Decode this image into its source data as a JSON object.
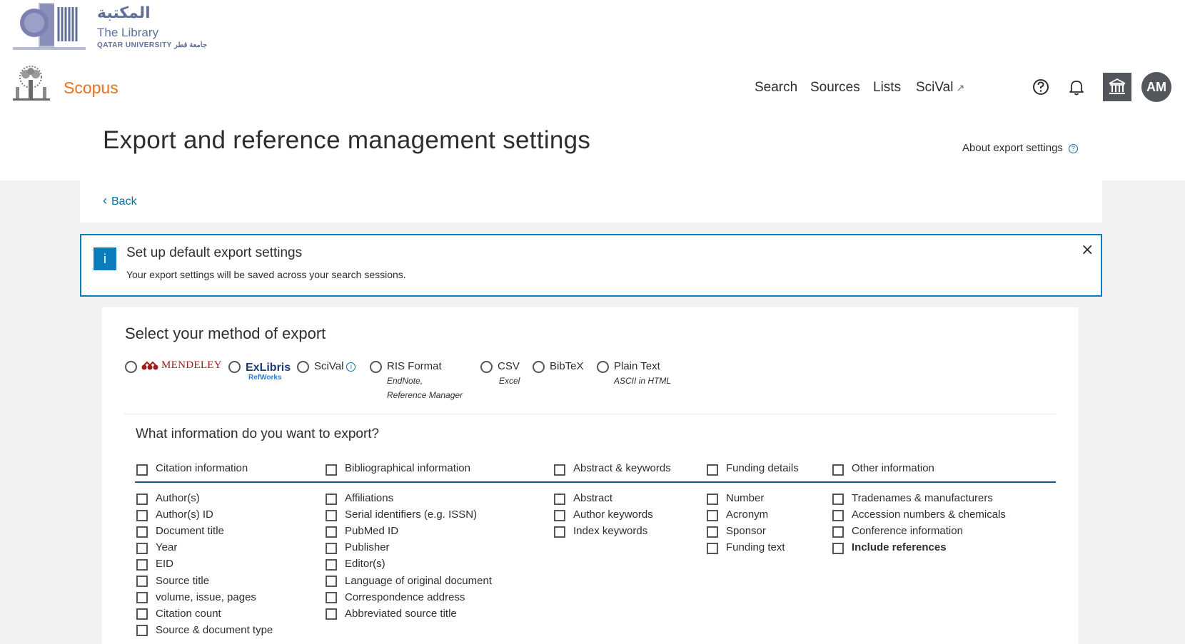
{
  "library": {
    "arabic": "المكتبة",
    "name": "The Library",
    "university": "QATAR UNIVERSITY جامعة قطر"
  },
  "header": {
    "brand": "Scopus",
    "nav": [
      "Search",
      "Sources",
      "Lists",
      "SciVal"
    ],
    "scival_arrow": "↗",
    "avatar_initials": "AM",
    "icons": [
      "help-icon",
      "bell-icon",
      "institution-icon"
    ]
  },
  "page": {
    "title": "Export and reference management settings",
    "about_link": "About export settings",
    "back": "Back"
  },
  "banner": {
    "icon": "i",
    "title": "Set up default export settings",
    "text": "Your export settings will be saved across your search sessions.",
    "close": "×"
  },
  "export": {
    "heading": "Select your method of export",
    "methods": [
      {
        "label": "MENDELEY"
      },
      {
        "label": "ExLibris",
        "sub": "RefWorks"
      },
      {
        "label": "SciVal"
      },
      {
        "label": "RIS Format",
        "sub1": "EndNote,",
        "sub2": "Reference Manager"
      },
      {
        "label": "CSV",
        "sub1": "Excel"
      },
      {
        "label": "BibTeX"
      },
      {
        "label": "Plain Text",
        "sub1": "ASCII in HTML"
      }
    ]
  },
  "info": {
    "heading": "What information do you want to export?",
    "groups": [
      {
        "title": "Citation information",
        "items": [
          "Author(s)",
          "Author(s) ID",
          "Document title",
          "Year",
          "EID",
          "Source title",
          "volume, issue, pages",
          "Citation count",
          "Source & document type"
        ]
      },
      {
        "title": "Bibliographical information",
        "items": [
          "Affiliations",
          "Serial identifiers (e.g. ISSN)",
          "PubMed ID",
          "Publisher",
          "Editor(s)",
          "Language of original document",
          "Correspondence address",
          "Abbreviated source title"
        ]
      },
      {
        "title": "Abstract & keywords",
        "items": [
          "Abstract",
          "Author keywords",
          "Index keywords"
        ]
      },
      {
        "title": "Funding details",
        "items": [
          "Number",
          "Acronym",
          "Sponsor",
          "Funding text"
        ]
      },
      {
        "title": "Other information",
        "items": [
          "Tradenames & manufacturers",
          "Accession numbers & chemicals",
          "Conference information",
          "Include references"
        ]
      }
    ]
  },
  "colors": {
    "scopus_orange": "#e9711c",
    "link_blue": "#007398",
    "banner_blue": "#0c7dbb",
    "mendeley_red": "#a01a1a",
    "dark_gray": "#53565a"
  }
}
